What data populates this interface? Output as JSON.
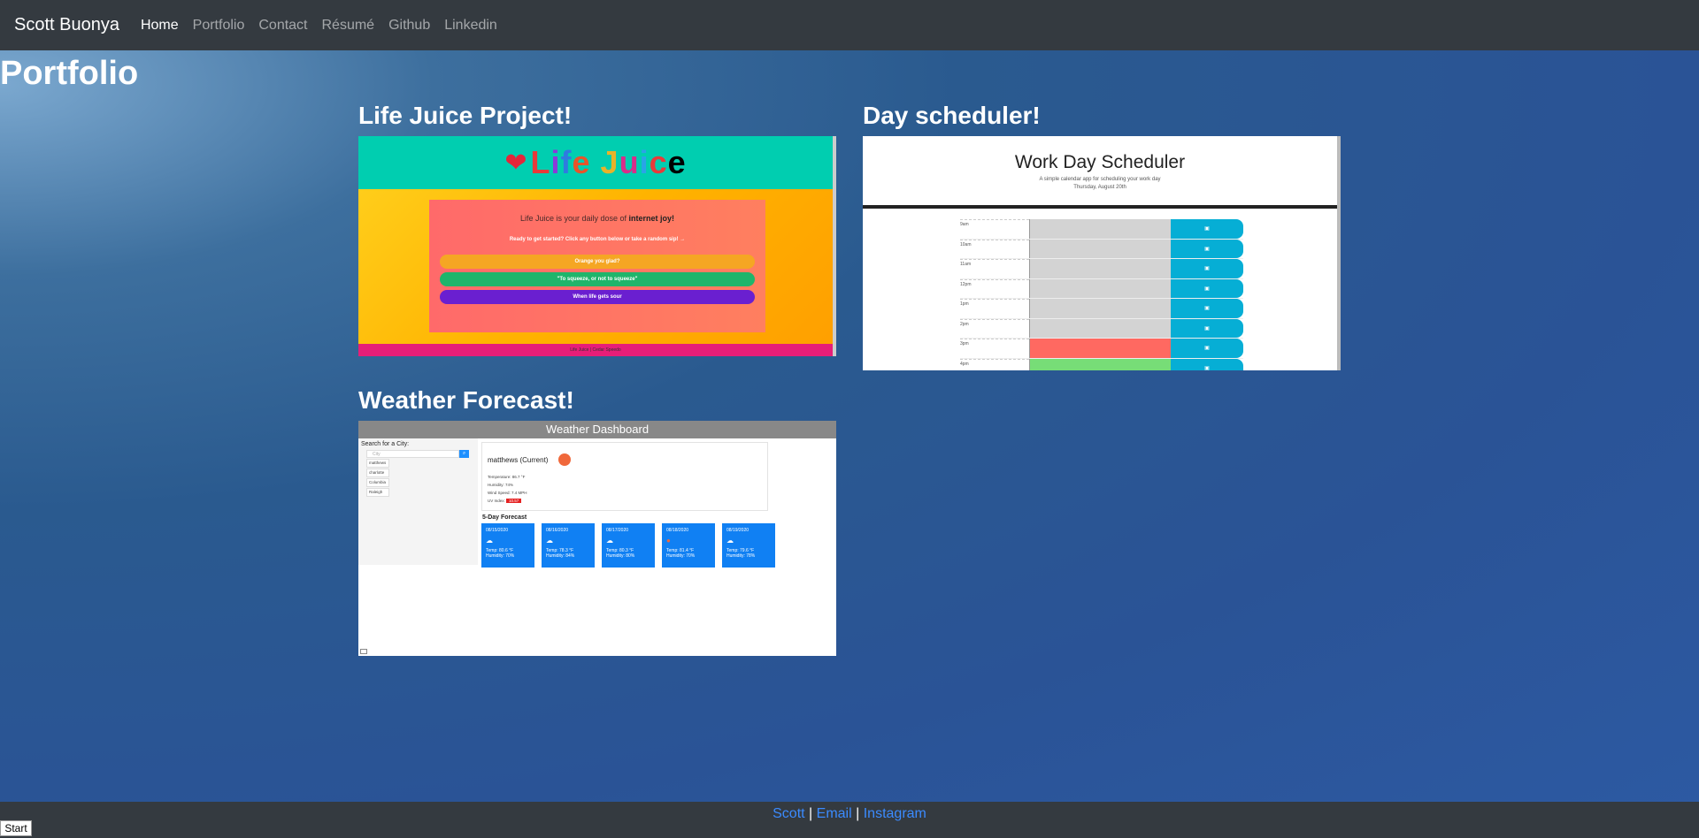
{
  "nav": {
    "brand": "Scott Buonya",
    "items": [
      {
        "label": "Home"
      },
      {
        "label": "Portfolio"
      },
      {
        "label": "Contact"
      },
      {
        "label": "Résumé"
      },
      {
        "label": "Github"
      },
      {
        "label": "Linkedin"
      }
    ]
  },
  "page_title": "Portfolio",
  "projects": {
    "life_juice": {
      "title": "Life Juice Project!",
      "logo": "Life Juice",
      "tagline_prefix": "Life Juice is your daily dose of ",
      "tagline_bold": "internet joy!",
      "ready": "Ready to get started? Click any button below or take a random sip! →",
      "buttons": [
        "Orange you glad?",
        "\"To squeeze, or not to squeeze\"",
        "When life gets sour"
      ],
      "footer": "Life Juice | Cedar Speedo"
    },
    "scheduler": {
      "title": "Day scheduler!",
      "app_title": "Work Day Scheduler",
      "subtitle": "A simple calendar app for scheduling your work day",
      "date": "Thursday, August 20th",
      "hours": [
        "9am",
        "10am",
        "11am",
        "12pm",
        "1pm",
        "2pm",
        "3pm",
        "4pm"
      ]
    },
    "weather": {
      "title": "Weather Forecast!",
      "header": "Weather Dashboard",
      "search_label": "Search for a City:",
      "search_placeholder": "City",
      "cities": [
        "matthews",
        "charlotte",
        "Columbia",
        "Raleigh"
      ],
      "current_city": "matthews (Current)",
      "temperature": "Temperature: 86.7 °F",
      "humidity": "Humidity: 74%",
      "wind": "Wind Speed: 7.4 MPH",
      "uv_label": "UV Index:",
      "uv_value": "10.57",
      "forecast_label": "5-Day Forecast",
      "forecast": [
        {
          "date": "08/15/2020",
          "temp": "Temp: 80.6 °F",
          "hum": "Humidity: 70%"
        },
        {
          "date": "08/16/2020",
          "temp": "Temp: 78.3 °F",
          "hum": "Humidity: 84%"
        },
        {
          "date": "08/17/2020",
          "temp": "Temp: 80.3 °F",
          "hum": "Humidity: 80%"
        },
        {
          "date": "08/18/2020",
          "temp": "Temp: 81.4 °F",
          "hum": "Humidity: 70%"
        },
        {
          "date": "08/19/2020",
          "temp": "Temp: 79.6 °F",
          "hum": "Humidity: 78%"
        }
      ]
    }
  },
  "footer": {
    "links": [
      "Scott",
      "Email",
      "Instagram"
    ],
    "separator": "|"
  },
  "taskbar": {
    "start": "Start"
  }
}
